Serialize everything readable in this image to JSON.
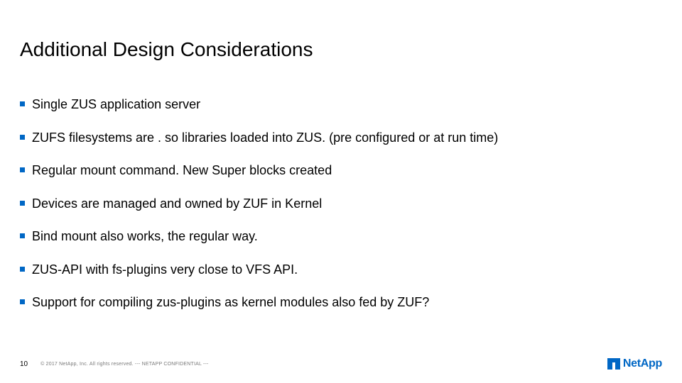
{
  "title": "Additional Design Considerations",
  "bullets": [
    "Single ZUS application server",
    "ZUFS filesystems are . so libraries loaded into ZUS. (pre configured or at run time)",
    "Regular mount command. New Super blocks created",
    "Devices are managed and owned by ZUF in Kernel",
    "Bind mount also works, the regular way.",
    "ZUS-API with fs-plugins very close to VFS API.",
    "Support for compiling zus-plugins as kernel modules also fed by ZUF?"
  ],
  "footer": {
    "page": "10",
    "copyright": "© 2017 NetApp, Inc. All rights reserved.   --- NETAPP CONFIDENTIAL ---",
    "logo_text": "NetApp"
  }
}
